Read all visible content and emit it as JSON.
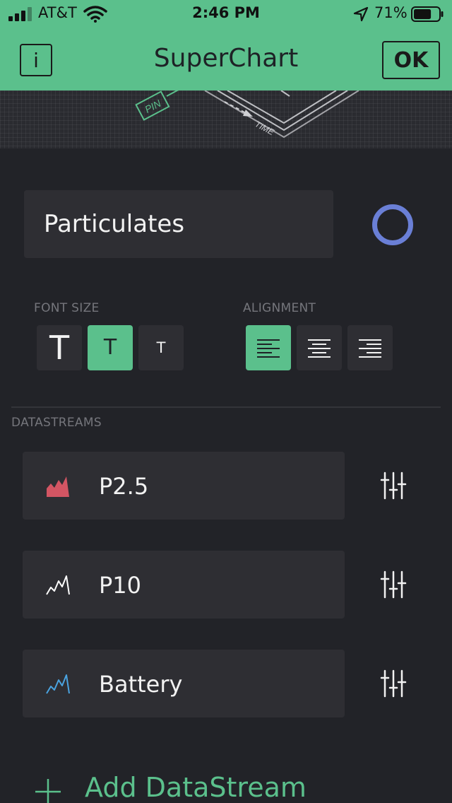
{
  "status_bar": {
    "carrier": "AT&T",
    "time": "2:46 PM",
    "battery_percent": "71%",
    "battery_level": 0.71
  },
  "nav": {
    "info_label": "i",
    "title": "SuperChart",
    "ok_label": "OK"
  },
  "preview": {
    "pin_label": "PIN",
    "time_label": "TIME"
  },
  "chart_title": {
    "value": "Particulates",
    "color": "#6a7fd6"
  },
  "font_size": {
    "label": "FONT SIZE",
    "options": [
      {
        "label": "T",
        "size": "large",
        "selected": false
      },
      {
        "label": "T",
        "size": "medium",
        "selected": true
      },
      {
        "label": "T",
        "size": "small",
        "selected": false
      }
    ]
  },
  "alignment": {
    "label": "ALIGNMENT",
    "options": [
      {
        "name": "left",
        "selected": true
      },
      {
        "name": "center",
        "selected": false
      },
      {
        "name": "right",
        "selected": false
      }
    ]
  },
  "datastreams": {
    "label": "DATASTREAMS",
    "items": [
      {
        "label": "P2.5",
        "icon": "area-chart-icon",
        "color": "#d35563"
      },
      {
        "label": "P10",
        "icon": "line-chart-icon",
        "color": "#ffffff"
      },
      {
        "label": "Battery",
        "icon": "line-chart-icon",
        "color": "#4aa3e0"
      }
    ],
    "add_label": "Add DataStream"
  },
  "colors": {
    "accent": "#5bc08c",
    "background": "#222328",
    "panel": "#2e2e33"
  }
}
